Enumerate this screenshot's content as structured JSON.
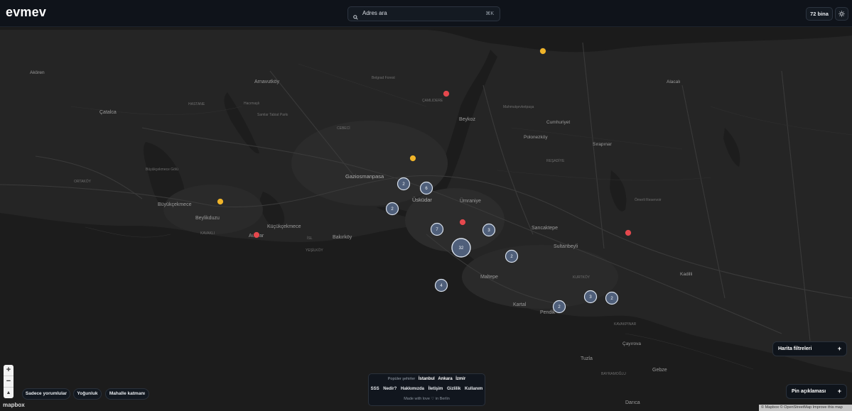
{
  "header": {
    "logo": "evmev",
    "search_placeholder": "Adres ara",
    "search_shortcut": "⌘K",
    "building_count": "72 bina"
  },
  "map": {
    "labels": {
      "akoren": "Akören",
      "arnavutkoy": "Arnavutköy",
      "hastane": "HASTANE",
      "hacimasli": "Hacımaşlı",
      "samlar": "Samlar Tabiat Parkı",
      "catalca": "Çatalca",
      "belgrad": "Belgrad Forest",
      "cekmece_lake": "Büyükçekmece Gölü",
      "ortakoy_w": "ORTAKÖY",
      "buyukcekmece": "Büyükçekmece",
      "beylikduzu": "Beylikduzu",
      "kucukcekmece": "Küçükçekmece",
      "kavakli": "KAVAKLI",
      "avcilar": "Avcılar",
      "bakirkoy": "Bakırköy",
      "yesilkoy": "YEŞİLKÖY",
      "isl": "İSL",
      "gaziosmanpasa": "Gaziosmanpasa",
      "cebeci": "CEBECİ",
      "beykoz": "Beykoz",
      "catalca_n": "ÇAMLIDERE",
      "mahmutsevket": "Mahmutşevketpaşa",
      "cumhuriyet": "Cumhuriyet",
      "polonezkoy": "Polonezköy",
      "sirapinar": "Sırapınar",
      "uskudar": "Üsküdar",
      "umraniye": "Ümraniye",
      "sancaktepe": "Sancaktepe",
      "sultanbeyli": "Sultanbeyli",
      "maltepe": "Maltepe",
      "kartal": "Kartal",
      "pendik": "Pendik",
      "omerli": "Ömerli Reservoir",
      "alacali": "Alacalı",
      "kadilli": "Kadilli",
      "tuzla": "Tuzla",
      "gebze": "Gebze",
      "darica": "Darıca",
      "bayramoglu": "BAYRAMOĞLU",
      "cayirova": "Çayırova",
      "kurtkoy": "KURTKÖY",
      "resadiye": "REŞADİYE",
      "kavak": "KAVAKPINAR"
    },
    "clusters": [
      "2",
      "6",
      "2",
      "7",
      "3",
      "32",
      "2",
      "4",
      "2",
      "3",
      "2"
    ],
    "colors": {
      "cluster_fill": "#4f5f7a",
      "pin_red": "#e5484d",
      "pin_yellow": "#f0b429"
    }
  },
  "controls": {
    "zoom_in": "+",
    "zoom_out": "−",
    "compass": "▲",
    "filter_buttons": [
      "Sadece yorumlular",
      "Yoğunluk",
      "Mahalle katmanı"
    ]
  },
  "footer": {
    "popular_label": "Popüler şehirler",
    "cities": [
      "İstanbul",
      "Ankara",
      "İzmir"
    ],
    "links": [
      "SSS",
      "Nedir?",
      "Hakkımızda",
      "İletişim",
      "Gizlilik",
      "Kullanım"
    ],
    "credit": "Made with love ♡ in Berlin"
  },
  "panels": {
    "map_filters": "Harita filtreleri",
    "pin_legend": "Pin açıklaması",
    "plus": "+"
  },
  "attribution": {
    "mapbox_logo": "mapbox",
    "text": "© Mapbox © OpenStreetMap  Improve this map"
  }
}
